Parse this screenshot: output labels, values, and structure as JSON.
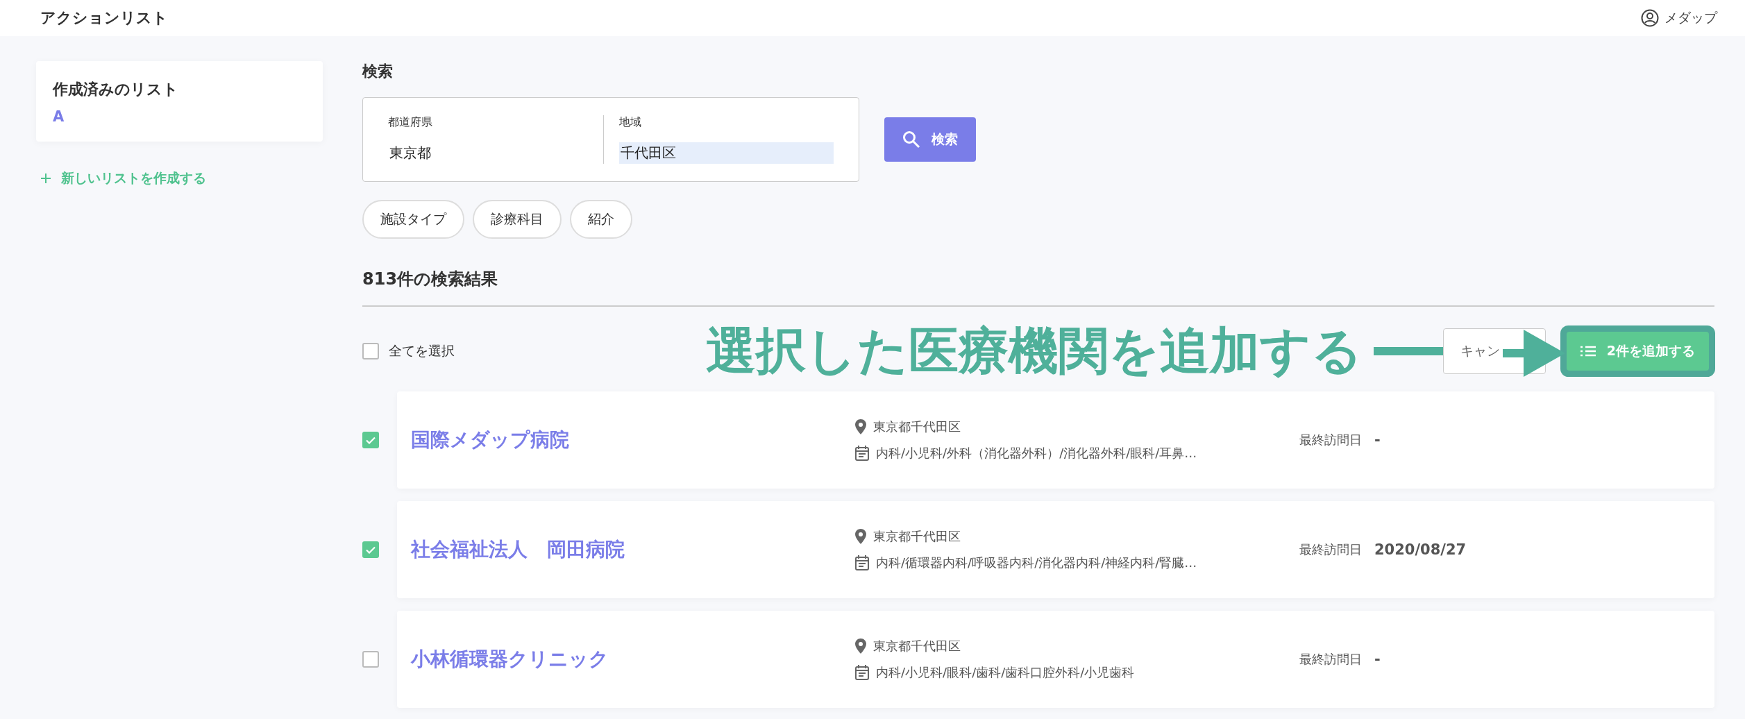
{
  "header": {
    "title": "アクションリスト",
    "user": "メダップ"
  },
  "sidebar": {
    "heading": "作成済みのリスト",
    "lists": [
      {
        "label": "A"
      }
    ],
    "create_link": "新しいリストを作成する"
  },
  "search": {
    "heading": "検索",
    "fields": [
      {
        "label": "都道府県",
        "value": "東京都",
        "highlighted": false
      },
      {
        "label": "地域",
        "value": "千代田区",
        "highlighted": true
      }
    ],
    "button": "検索",
    "filters": [
      "施設タイプ",
      "診療科目",
      "紹介"
    ]
  },
  "results": {
    "count_title": "813件の検索結果",
    "select_all": {
      "label": "全てを選択",
      "checked": false
    },
    "annotation": "選択した医療機関を追加する",
    "cancel_button": "キャン",
    "add_button": "2件を追加する",
    "rows": [
      {
        "name": "国際メダップ病院",
        "address": "東京都千代田区",
        "departments": "内科/小児科/外科（消化器外科）/消化器外科/眼科/耳鼻…",
        "visit_label": "最終訪問日",
        "visit_date": "-",
        "checked": true
      },
      {
        "name": "社会福祉法人　岡田病院",
        "address": "東京都千代田区",
        "departments": "内科/循環器内科/呼吸器内科/消化器内科/神経内科/腎臓…",
        "visit_label": "最終訪問日",
        "visit_date": "2020/08/27",
        "checked": true
      },
      {
        "name": "小林循環器クリニック",
        "address": "東京都千代田区",
        "departments": "内科/小児科/眼科/歯科/歯科口腔外科/小児歯科",
        "visit_label": "最終訪問日",
        "visit_date": "-",
        "checked": false
      }
    ]
  }
}
